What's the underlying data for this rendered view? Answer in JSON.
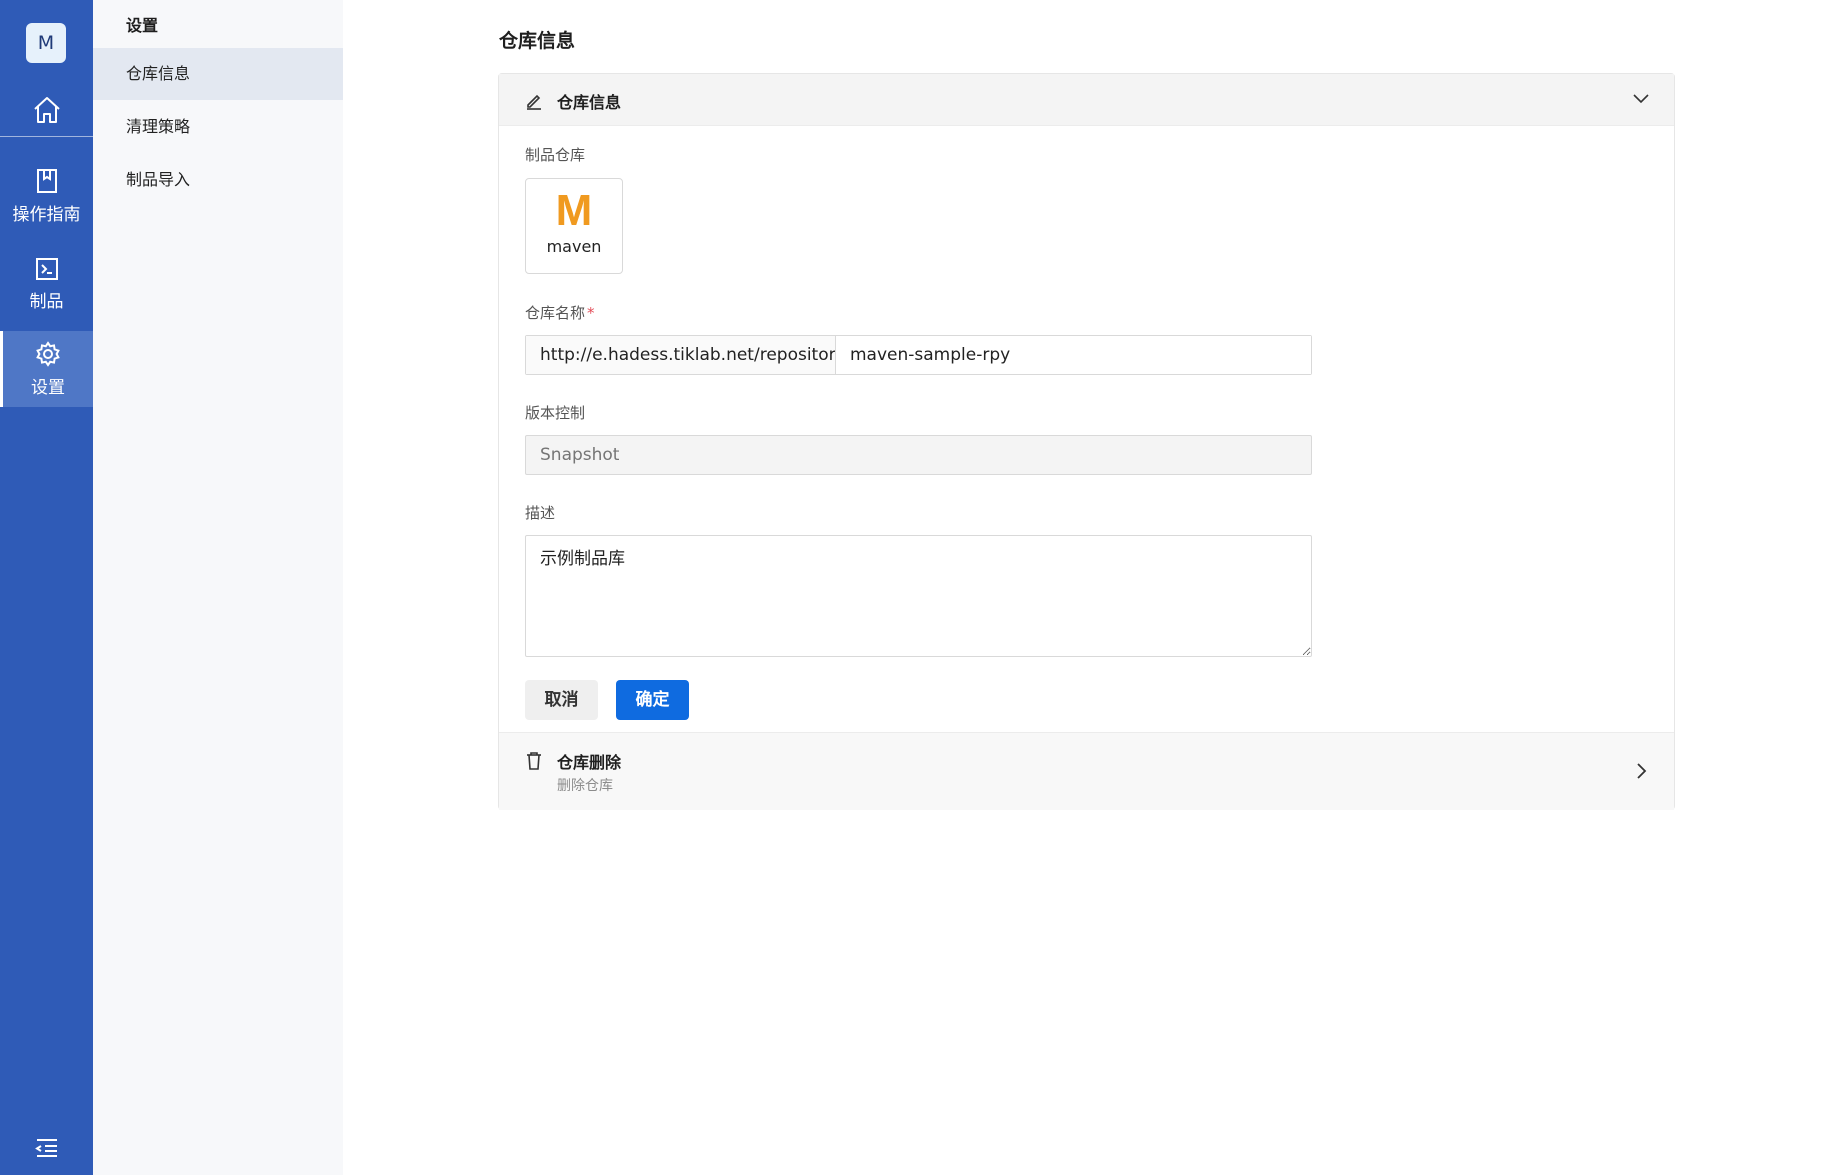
{
  "rail": {
    "avatar": "M",
    "items": [
      {
        "label": "操作指南",
        "icon": "book-icon"
      },
      {
        "label": "制品",
        "icon": "terminal-icon"
      },
      {
        "label": "设置",
        "icon": "gear-icon"
      }
    ]
  },
  "subnav": {
    "title": "设置",
    "items": [
      {
        "label": "仓库信息",
        "active": true
      },
      {
        "label": "清理策略",
        "active": false
      },
      {
        "label": "制品导入",
        "active": false
      }
    ]
  },
  "main": {
    "page_title": "仓库信息",
    "section_title": "仓库信息",
    "type_label": "制品仓库",
    "type_logo": "M",
    "type_name": "maven",
    "name_label": "仓库名称",
    "required_mark": "*",
    "url_prefix": "http://e.hadess.tiklab.net/repository/",
    "repo_name": "maven-sample-rpy",
    "version_label": "版本控制",
    "version_value": "Snapshot",
    "desc_label": "描述",
    "desc_value": "示例制品库",
    "cancel_label": "取消",
    "ok_label": "确定",
    "delete_title": "仓库删除",
    "delete_sub": "删除仓库"
  },
  "colors": {
    "rail": "#2f5bb7",
    "primary": "#0f6be0",
    "maven_logo": "#f09a20"
  }
}
